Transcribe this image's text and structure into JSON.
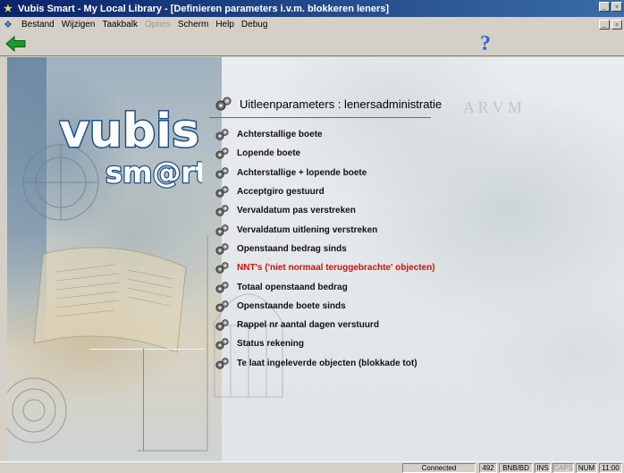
{
  "window": {
    "title": "Vubis Smart - My Local Library - [Definieren parameters i.v.m. blokkeren leners]"
  },
  "menu": {
    "items": [
      {
        "label": "Bestand",
        "enabled": true
      },
      {
        "label": "Wijzigen",
        "enabled": true
      },
      {
        "label": "Taakbalk",
        "enabled": true
      },
      {
        "label": "Opties",
        "enabled": false
      },
      {
        "label": "Scherm",
        "enabled": true
      },
      {
        "label": "Help",
        "enabled": true
      },
      {
        "label": "Debug",
        "enabled": true
      }
    ]
  },
  "toolbar": {
    "help_label": "?"
  },
  "logo": {
    "line1": "vubis",
    "line2": "sm@rt"
  },
  "heading": "Uitleenparameters : lenersadministratie",
  "options": [
    {
      "label": "Achterstallige boete",
      "highlight": false
    },
    {
      "label": "Lopende boete",
      "highlight": false
    },
    {
      "label": "Achterstallige + lopende boete",
      "highlight": false
    },
    {
      "label": "Acceptgiro gestuurd",
      "highlight": false
    },
    {
      "label": "Vervaldatum pas verstreken",
      "highlight": false
    },
    {
      "label": "Vervaldatum uitlening verstreken",
      "highlight": false
    },
    {
      "label": "Openstaand bedrag sinds",
      "highlight": false
    },
    {
      "label": "NNT's ('niet normaal teruggebrachte' objecten)",
      "highlight": true
    },
    {
      "label": "Totaal openstaand bedrag",
      "highlight": false
    },
    {
      "label": "Openstaande boete sinds",
      "highlight": false
    },
    {
      "label": "Rappel nr aantal dagen verstuurd",
      "highlight": false
    },
    {
      "label": "Status rekening",
      "highlight": false
    },
    {
      "label": "Te laat ingeleverde objecten (blokkade tot)",
      "highlight": false
    }
  ],
  "statusbar": {
    "connection": "Connected",
    "session_number": "492",
    "workstation": "BNB/BD",
    "ins": "INS",
    "caps": "CAPS",
    "num": "NUM",
    "time": "11:00"
  },
  "colors": {
    "titlebar_start": "#0a246a",
    "titlebar_end": "#3a6ea5",
    "highlight_option": "#cc1111",
    "back_arrow": "#1e9a2a",
    "help_icon": "#2a6acd"
  }
}
